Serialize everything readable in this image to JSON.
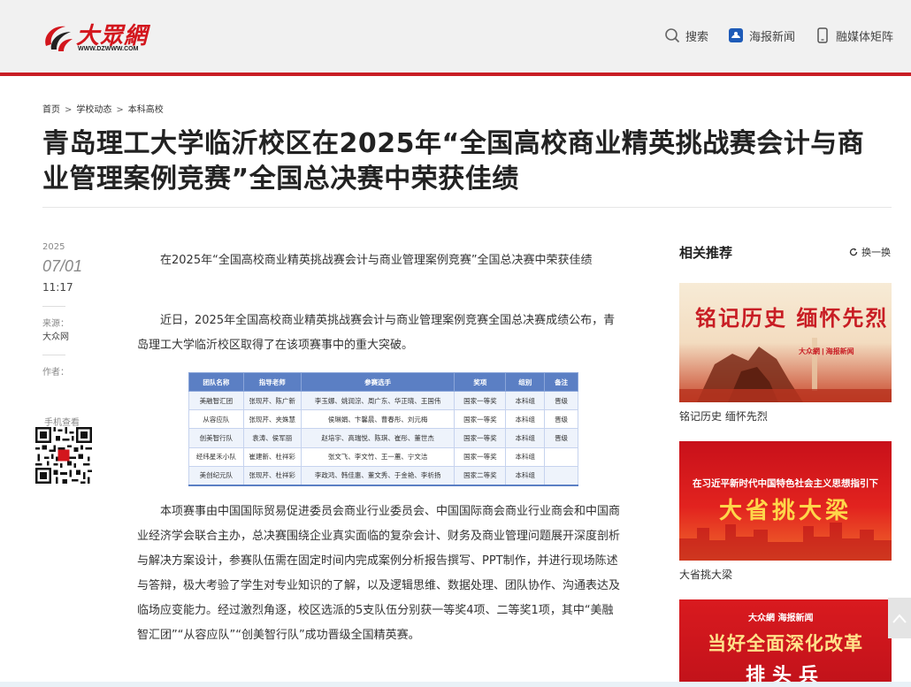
{
  "header": {
    "logo_text": "大眾網",
    "logo_url": "WWW.DZWWW.COM",
    "nav": [
      {
        "label": "搜索",
        "icon": "search-icon"
      },
      {
        "label": "海报新闻",
        "icon": "haibao-app-icon"
      },
      {
        "label": "融媒体矩阵",
        "icon": "mobile-phone-icon"
      }
    ]
  },
  "breadcrumb": [
    "首页",
    "学校动态",
    "本科高校"
  ],
  "article": {
    "title": "青岛理工大学临沂校区在2025年“全国高校商业精英挑战赛会计与商业管理案例竞赛”全国总决赛中荣获佳绩",
    "meta": {
      "year": "2025",
      "date": "07/01",
      "time": "11:17",
      "source_label": "来源：",
      "source": "大众网",
      "author_label": "作者：",
      "phone_label": "手机查看"
    },
    "paragraphs": [
      "在2025年“全国高校商业精英挑战赛会计与商业管理案例竞赛”全国总决赛中荣获佳绩",
      "近日，2025年全国高校商业精英挑战赛会计与商业管理案例竞赛全国总决赛成绩公布，青岛理工大学临沂校区取得了在该项赛事中的重大突破。",
      "本项赛事由中国国际贸易促进委员会商业行业委员会、中国国际商会商业行业商会和中国商业经济学会联合主办，总决赛围绕企业真实面临的复杂会计、财务及商业管理问题展开深度剖析与解决方案设计，参赛队伍需在固定时间内完成案例分析报告撰写、PPT制作，并进行现场陈述与答辩，极大考验了学生对专业知识的了解，以及逻辑思维、数据处理、团队协作、沟通表达及临场应变能力。经过激烈角逐，校区选派的5支队伍分别获一等奖4项、二等奖1项，其中“美融智汇团”“从容应队”“创美智行队”成功晋级全国精英赛。"
    ],
    "table": {
      "headers": [
        "团队名称",
        "指导老师",
        "参赛选手",
        "奖项",
        "组别",
        "备注"
      ],
      "rows": [
        [
          "美融智汇团",
          "张现芹、陈广新",
          "李玉娜、姚润淙、周广东、华正晓、王国伟",
          "国家一等奖",
          "本科组",
          "晋级"
        ],
        [
          "从容应队",
          "张现芹、夹姝慧",
          "侯琳娟、卞馨晨、曹春彤、刘元梅",
          "国家一等奖",
          "本科组",
          "晋级"
        ],
        [
          "创美智行队",
          "袁涛、侯军丽",
          "赵培宇、高瑞悦、陈琪、崔彤、董世杰",
          "国家一等奖",
          "本科组",
          "晋级"
        ],
        [
          "经纬星禾小队",
          "崔建新、杜祥彩",
          "张文飞、李文竹、王一蕙、宁文洁",
          "国家一等奖",
          "本科组",
          ""
        ],
        [
          "美创纪元队",
          "张现芹、杜祥彩",
          "李政鸿、韩佳惠、董文秀、于金艳、李析扬",
          "国家二等奖",
          "本科组",
          ""
        ]
      ]
    }
  },
  "sidebar": {
    "title": "相关推荐",
    "refresh_label": "换一换",
    "cards": [
      {
        "caption": "铭记历史 缅怀先烈",
        "image_text": "铭记历史 缅怀先烈"
      },
      {
        "caption": "大省挑大梁",
        "image_top": "在习近平新时代中国特色社会主义思想指引下",
        "image_text": "大省挑大梁"
      },
      {
        "caption": "",
        "image_top": "大众網 海报新闻",
        "image_text": "当好全面深化改革",
        "image_text2": "排头兵"
      }
    ]
  },
  "colors": {
    "brand_red": "#c81d24",
    "table_header": "#5b7fc4"
  }
}
